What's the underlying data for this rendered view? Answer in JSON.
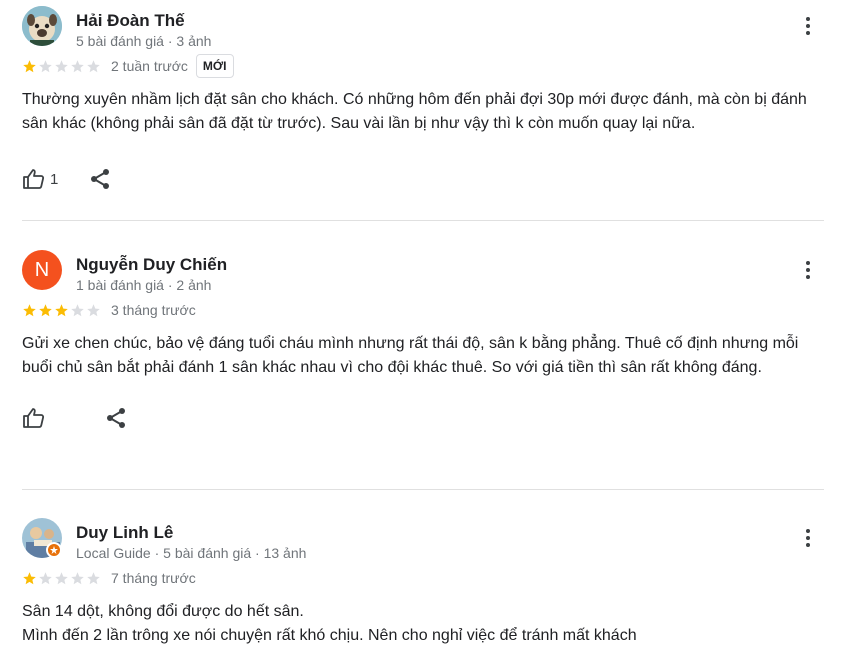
{
  "reviews": [
    {
      "name": "Hải Đoàn Thế",
      "meta": "5 bài đánh giá · 3 ảnh",
      "rating": 1,
      "time": "2 tuần trước",
      "badge": "MỚI",
      "text": "Thường xuyên nhầm lịch đặt sân cho khách. Có những hôm đến phải đợi 30p mới được đánh, mà còn bị đánh sân khác (không phải sân đã đặt từ trước). Sau vài lần bị như vậy thì k còn muốn quay lại nữa.",
      "likes": "1"
    },
    {
      "name": "Nguyễn Duy Chiến",
      "avatar_letter": "N",
      "meta": "1 bài đánh giá · 2 ảnh",
      "rating": 3,
      "time": "3 tháng trước",
      "text": "Gửi xe chen chúc, bảo vệ đáng tuổi cháu mình nhưng rất thái độ, sân k bằng phẳng. Thuê cố định nhưng mỗi buổi chủ sân bắt phải đánh 1 sân khác nhau vì cho đội khác thuê. So với giá tiền thì sân rất không đáng.",
      "likes": ""
    },
    {
      "name": "Duy Linh Lê",
      "meta": "Local Guide · 5 bài đánh giá · 13 ảnh",
      "rating": 1,
      "time": "7 tháng trước",
      "text": "Sân 14 dột, không đổi được do hết sân.\nMình đến 2 lần trông xe nói chuyện rất khó chịu. Nên cho nghỉ việc để tránh mất khách"
    }
  ],
  "colors": {
    "star_filled": "#fbbc04",
    "star_empty": "#dadce0",
    "avatar_n": "#f4511e",
    "local_guide": "#e8710a"
  },
  "icons": [
    "dog-avatar",
    "person-avatar",
    "more-vert-icon",
    "star-icon",
    "thumb-up-icon",
    "share-icon",
    "local-guide-icon"
  ]
}
